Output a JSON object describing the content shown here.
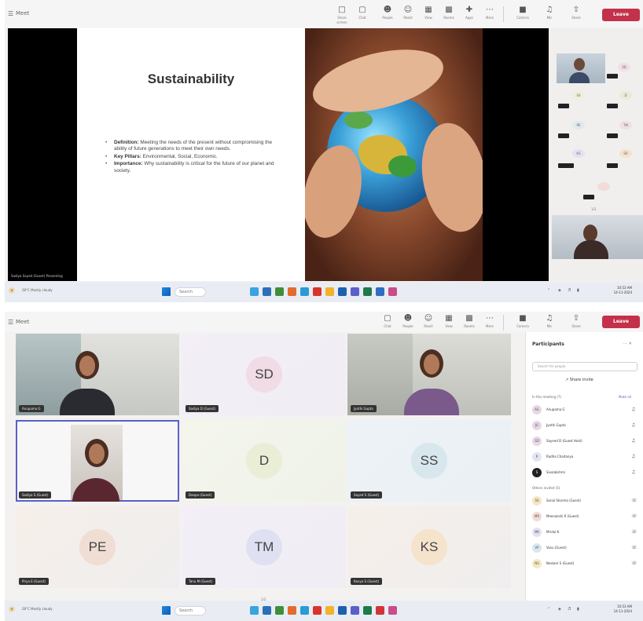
{
  "meeting": {
    "title": "Meet",
    "toolbar": [
      {
        "label": "Share screen",
        "icon": "monitor-icon"
      },
      {
        "label": "Chat",
        "icon": "chat-icon"
      },
      {
        "label": "People",
        "icon": "people-icon"
      },
      {
        "label": "React",
        "icon": "react-icon"
      },
      {
        "label": "View",
        "icon": "view-icon"
      },
      {
        "label": "Rooms",
        "icon": "rooms-icon"
      },
      {
        "label": "Apps",
        "icon": "apps-icon"
      },
      {
        "label": "More",
        "icon": "more-icon"
      },
      {
        "label": "Camera",
        "icon": "camera-icon"
      },
      {
        "label": "Mic",
        "icon": "mic-icon"
      },
      {
        "label": "Share",
        "icon": "share-icon"
      }
    ],
    "leave_label": "Leave"
  },
  "slide": {
    "title": "Sustainability",
    "caption": "Sadiya Sayed (Guest) Presenting",
    "bullets": [
      {
        "term": "Definition:",
        "text": "Meeting the needs of the present without compromising the ability of future generations to meet their own needs."
      },
      {
        "term": "Key Pillars:",
        "text": "Environmental, Social, Economic."
      },
      {
        "term": "Importance:",
        "text": "Why sustainability is critical for the future of our planet and society."
      }
    ]
  },
  "gallery": {
    "page": "1/3",
    "avatars": [
      "SD",
      "SS",
      "D",
      "PE",
      "TM",
      "KS",
      "SR"
    ]
  },
  "taskbar": {
    "weather_temp": "28°C",
    "weather_desc": "Mostly cloudy",
    "search_placeholder": "Search",
    "time": "10:53 AM",
    "date": "14-11-2024"
  },
  "grid": {
    "page": "1/2",
    "tiles": [
      {
        "type": "camera",
        "name": "Anupama G"
      },
      {
        "type": "avatar",
        "initials": "SD",
        "name": "Sadiya D (Guest)"
      },
      {
        "type": "camera",
        "name": "Jyothi Gupta"
      },
      {
        "type": "camera",
        "name": "Sadiya S (Guest)"
      },
      {
        "type": "avatar",
        "initials": "D",
        "name": "Deepa (Guest)"
      },
      {
        "type": "avatar",
        "initials": "SS",
        "name": "Sayed S (Guest)"
      },
      {
        "type": "avatar",
        "initials": "PE",
        "name": "Priya E (Guest)"
      },
      {
        "type": "avatar",
        "initials": "TM",
        "name": "Tanu M (Guest)"
      },
      {
        "type": "avatar",
        "initials": "KS",
        "name": "Kavya S (Guest)"
      }
    ]
  },
  "participants": {
    "title": "Participants",
    "search_placeholder": "Search for people",
    "share_invite": "Share invite",
    "in_meeting": "In this meeting (7)",
    "mute_all": "Mute all",
    "others": "Others invited (5)",
    "in_meeting_list": [
      {
        "initials": "AG",
        "name": "Anupama G"
      },
      {
        "initials": "JG",
        "name": "Jyothi Gupta"
      },
      {
        "initials": "SD",
        "name": "Sayeed D (Guest Host)"
      },
      {
        "initials": "R",
        "name": "Radha Chaitanya"
      },
      {
        "initials": "S",
        "name": "Sivalakshmi"
      }
    ],
    "others_list": [
      {
        "initials": "SS",
        "name": "Sonal Sharma (Guest)"
      },
      {
        "initials": "MR",
        "name": "Meenakshi R (Guest)"
      },
      {
        "initials": "MK",
        "name": "Mridul K"
      },
      {
        "initials": "VP",
        "name": "Vasu (Guest)"
      },
      {
        "initials": "NS",
        "name": "Neelam S (Guest)"
      }
    ]
  }
}
